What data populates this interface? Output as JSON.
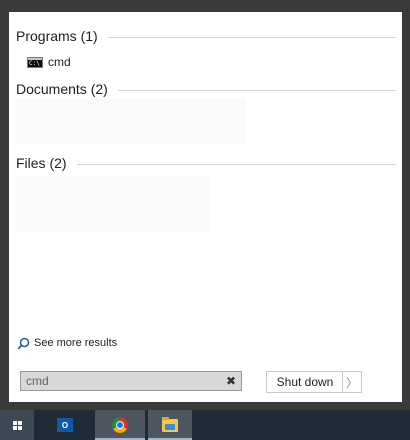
{
  "results": {
    "programs_header": "Programs (1)",
    "programs": [
      {
        "label": "cmd",
        "icon": "command-prompt-icon"
      }
    ],
    "documents_header": "Documents (2)",
    "files_header": "Files (2)"
  },
  "see_more": {
    "label": "See more results",
    "icon": "search-icon"
  },
  "search": {
    "value": "cmd",
    "clear_glyph": "✖"
  },
  "power": {
    "shutdown_label": "Shut down",
    "arrow_glyph": "〉"
  },
  "taskbar": {
    "apps": [
      {
        "name": "outlook",
        "icon": "outlook-icon",
        "glyph": "O"
      },
      {
        "name": "chrome",
        "icon": "chrome-icon"
      },
      {
        "name": "file-explorer",
        "icon": "file-explorer-icon"
      }
    ]
  },
  "colors": {
    "taskbar_bg": "#1f2b36",
    "menu_frame": "#3a3a3a",
    "panel_bg": "#ffffff"
  }
}
